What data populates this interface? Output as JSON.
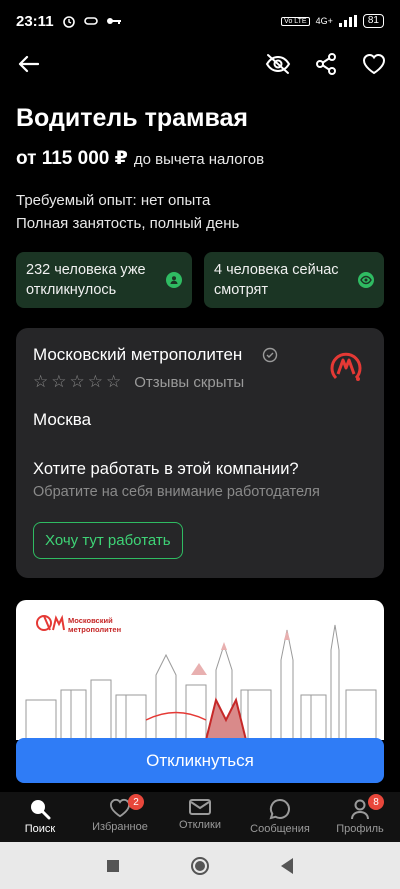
{
  "status": {
    "time": "23:11",
    "battery": "81",
    "network": "4G+"
  },
  "vacancy": {
    "title": "Водитель трамвая",
    "salary_amount": "от 115 000 ₽",
    "salary_note": "до вычета налогов",
    "experience": "Требуемый опыт: нет опыта",
    "employment": "Полная занятость, полный день"
  },
  "stats": {
    "responded": "232 человека уже откликнулось",
    "watching": "4 человека сейчас смотрят"
  },
  "company": {
    "name": "Московский метрополитен",
    "reviews": "Отзывы скрыты",
    "city": "Москва",
    "question": "Хотите работать в этой компании?",
    "hint": "Обратите на себя внимание работодателя",
    "want_button": "Хочу тут работать"
  },
  "banner": {
    "logo_line1": "Московский",
    "logo_line2": "метрополитен"
  },
  "apply_button": "Откликнуться",
  "nav": {
    "items": [
      {
        "label": "Поиск",
        "badge": ""
      },
      {
        "label": "Избранное",
        "badge": "2"
      },
      {
        "label": "Отклики",
        "badge": ""
      },
      {
        "label": "Сообщения",
        "badge": ""
      },
      {
        "label": "Профиль",
        "badge": "8"
      }
    ]
  },
  "colors": {
    "accent_green": "#2fbb62",
    "primary_blue": "#2f7cf6",
    "metro_red": "#e53935"
  }
}
